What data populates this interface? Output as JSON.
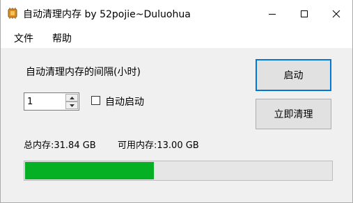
{
  "window": {
    "title": "自动清理内存 by 52pojie~Duluohua",
    "icon": "chip-icon"
  },
  "menu": {
    "file": "文件",
    "help": "帮助"
  },
  "main": {
    "interval_label": "自动清理内存的间隔(小时)",
    "interval_value": "1",
    "autostart_label": "自动启动",
    "autostart_checked": false,
    "start_button": "启动",
    "clear_button": "立即清理",
    "total_memory": "总内存:31.84 GB",
    "available_memory": "可用内存:13.00 GB",
    "memory_progress_fraction": 0.42,
    "progress_color": "#06b025"
  }
}
